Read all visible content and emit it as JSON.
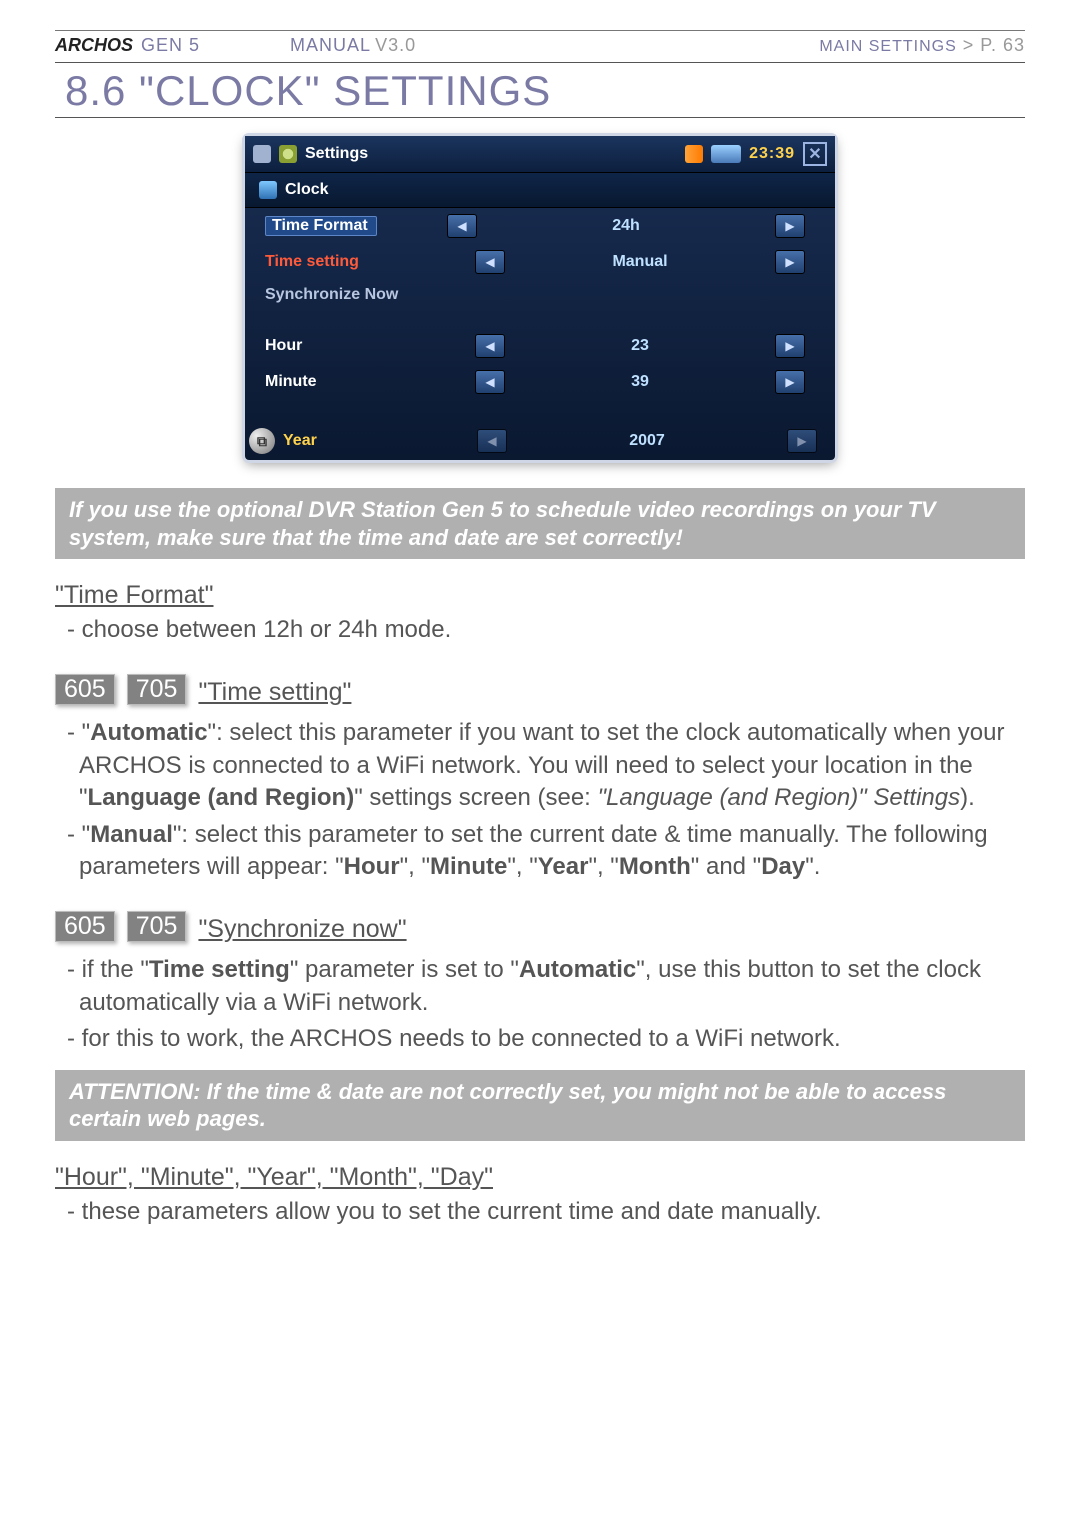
{
  "header": {
    "brand": "ARCHOS",
    "gen": "GEN 5",
    "manual": "MANUAL",
    "version": "V3.0",
    "breadcrumb": "MAIN SETTINGS",
    "arrow": ">",
    "page": "P. 63"
  },
  "title": "8.6  \"CLOCK\" SETTINGS",
  "screenshot": {
    "topbar": {
      "title": "Settings",
      "clock": "23:39"
    },
    "panel_title": "Clock",
    "rows": [
      {
        "label": "Time Format",
        "value": "24h",
        "selected": true
      },
      {
        "label": "Time setting",
        "value": "Manual"
      },
      {
        "label": "Synchronize Now",
        "value": "",
        "no_arrows": true,
        "dim": true
      }
    ],
    "rows2": [
      {
        "label": "Hour",
        "value": "23"
      },
      {
        "label": "Minute",
        "value": "39"
      }
    ],
    "year_row": {
      "label": "Year",
      "value": "2007"
    }
  },
  "note1": "If you use the optional DVR Station Gen 5 to schedule video recordings on your TV system, make sure that the time and date are set correctly!",
  "sec_time_format": {
    "heading": "\"Time Format\"",
    "items": [
      "choose between 12h or 24h mode."
    ]
  },
  "badges": {
    "a": "605",
    "b": "705"
  },
  "sec_time_setting": {
    "heading": "\"Time setting\"",
    "html_items": [
      "\"<b>Automatic</b>\": select this parameter if you want to set the clock automatically when your ARCHOS is connected to a WiFi network. You will need to select your location in the \"<b>Language (and Region)</b>\" settings screen (see: <i>\"Language (and Region)\" Settings</i>).",
      "\"<b>Manual</b>\": select this parameter to set the current date & time manually. The following parameters will appear: \"<b>Hour</b>\", \"<b>Minute</b>\", \"<b>Year</b>\", \"<b>Month</b>\" and \"<b>Day</b>\"."
    ]
  },
  "sec_sync": {
    "heading": "\"Synchronize now\"",
    "html_items": [
      "if the \"<b>Time setting</b>\" parameter is set to \"<b>Automatic</b>\", use this button to set the clock automatically via a WiFi network.",
      "for this to work, the ARCHOS needs to be connected to a WiFi network."
    ]
  },
  "note2": "ATTENTION: If the time & date are not correctly set, you might not be able to access certain web pages.",
  "sec_hmy": {
    "heading": "\"Hour\", \"Minute\", \"Year\", \"Month\", \"Day\"",
    "items": [
      "these parameters allow you to set the current time and date manually."
    ]
  }
}
